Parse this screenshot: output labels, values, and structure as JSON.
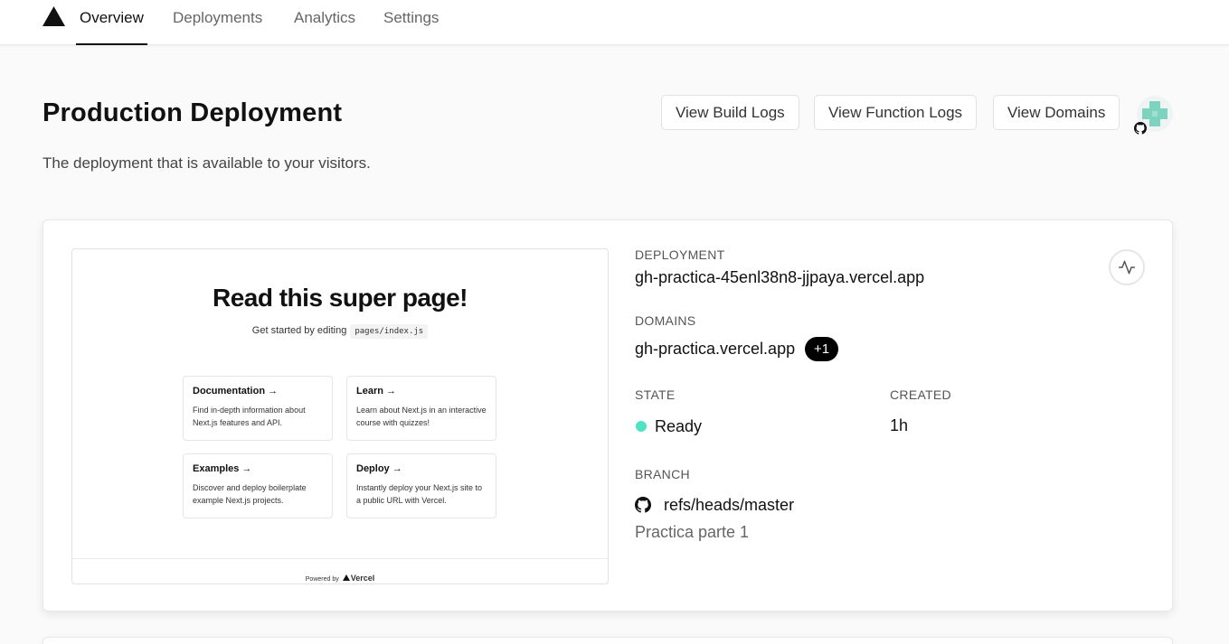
{
  "nav": {
    "logo": "vercel-triangle-icon",
    "tabs": [
      {
        "label": "Overview",
        "active": true
      },
      {
        "label": "Deployments",
        "active": false
      },
      {
        "label": "Analytics",
        "active": false
      },
      {
        "label": "Settings",
        "active": false
      }
    ]
  },
  "header": {
    "title": "Production Deployment",
    "subtitle": "The deployment that is available to your visitors.",
    "buttons": {
      "build_logs": "View Build Logs",
      "function_logs": "View Function Logs",
      "domains": "View Domains"
    }
  },
  "preview": {
    "title": "Read this super page!",
    "subtitle_text": "Get started by editing",
    "subtitle_code": "pages/index.js",
    "cards": [
      {
        "title": "Documentation →",
        "desc": "Find in-depth information about Next.js features and API."
      },
      {
        "title": "Learn →",
        "desc": "Learn about Next.js in an interactive course with quizzes!"
      },
      {
        "title": "Examples →",
        "desc": "Discover and deploy boilerplate example Next.js projects."
      },
      {
        "title": "Deploy →",
        "desc": "Instantly deploy your Next.js site to a public URL with Vercel."
      }
    ],
    "footer_text": "Powered by",
    "footer_brand": "Vercel"
  },
  "details": {
    "deployment_label": "DEPLOYMENT",
    "deployment_url": "gh-practica-45enl38n8-jjpaya.vercel.app",
    "domains_label": "DOMAINS",
    "domain": "gh-practica.vercel.app",
    "domains_extra": "+1",
    "state_label": "STATE",
    "state": "Ready",
    "created_label": "CREATED",
    "created": "1h",
    "branch_label": "BRANCH",
    "branch": "refs/heads/master",
    "commit_message": "Practica parte 1"
  },
  "colors": {
    "ready_status": "#50e3c2",
    "accent": "#000000"
  }
}
